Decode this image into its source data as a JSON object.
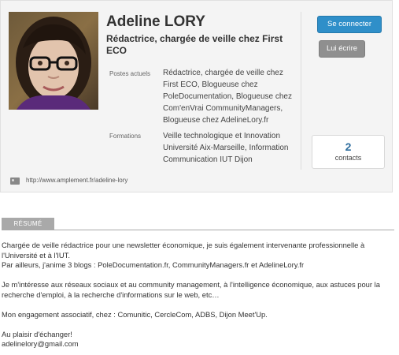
{
  "profile": {
    "name": "Adeline LORY",
    "headline": "Rédactrice, chargée de veille chez First ECO",
    "current_label": "Postes actuels",
    "current_value": "Rédactrice, chargée de veille chez First ECO, Blogueuse chez PoleDocumentation, Blogueuse chez Com'enVrai CommunityManagers, Blogueuse chez AdelineLory.fr",
    "education_label": "Formations",
    "education_value": "Veille technologique et Innovation Université Aix-Marseille, Information Communication IUT Dijon",
    "url": "http://www.amplement.fr/adeline-lory"
  },
  "actions": {
    "connect": "Se connecter",
    "write": "Lui écrire"
  },
  "contacts": {
    "count": "2",
    "label": "contacts"
  },
  "summary": {
    "tab": "RÉSUMÉ",
    "lines": [
      "Chargée de veille rédactrice pour une newsletter économique, je suis également intervenante professionnelle à l'Université et à l'IUT.",
      "Par ailleurs, j'anime 3 blogs : PoleDocumentation.fr, CommunityManagers.fr et AdelineLory.fr",
      "Je m'intéresse aux réseaux sociaux et au community management, à l'intelligence économique, aux astuces pour la recherche d'emploi, à la recherche d'informations sur le web, etc…",
      "Mon engagement associatif, chez : Comunitic, CercleCom, ADBS, Dijon Meet'Up.",
      "Au plaisir d'échanger!",
      "adelinelory@gmail.com"
    ]
  },
  "colors": {
    "primary_button": "#2f8fc9",
    "secondary_button": "#8f8f8f",
    "contacts_number": "#2f6e9e"
  }
}
